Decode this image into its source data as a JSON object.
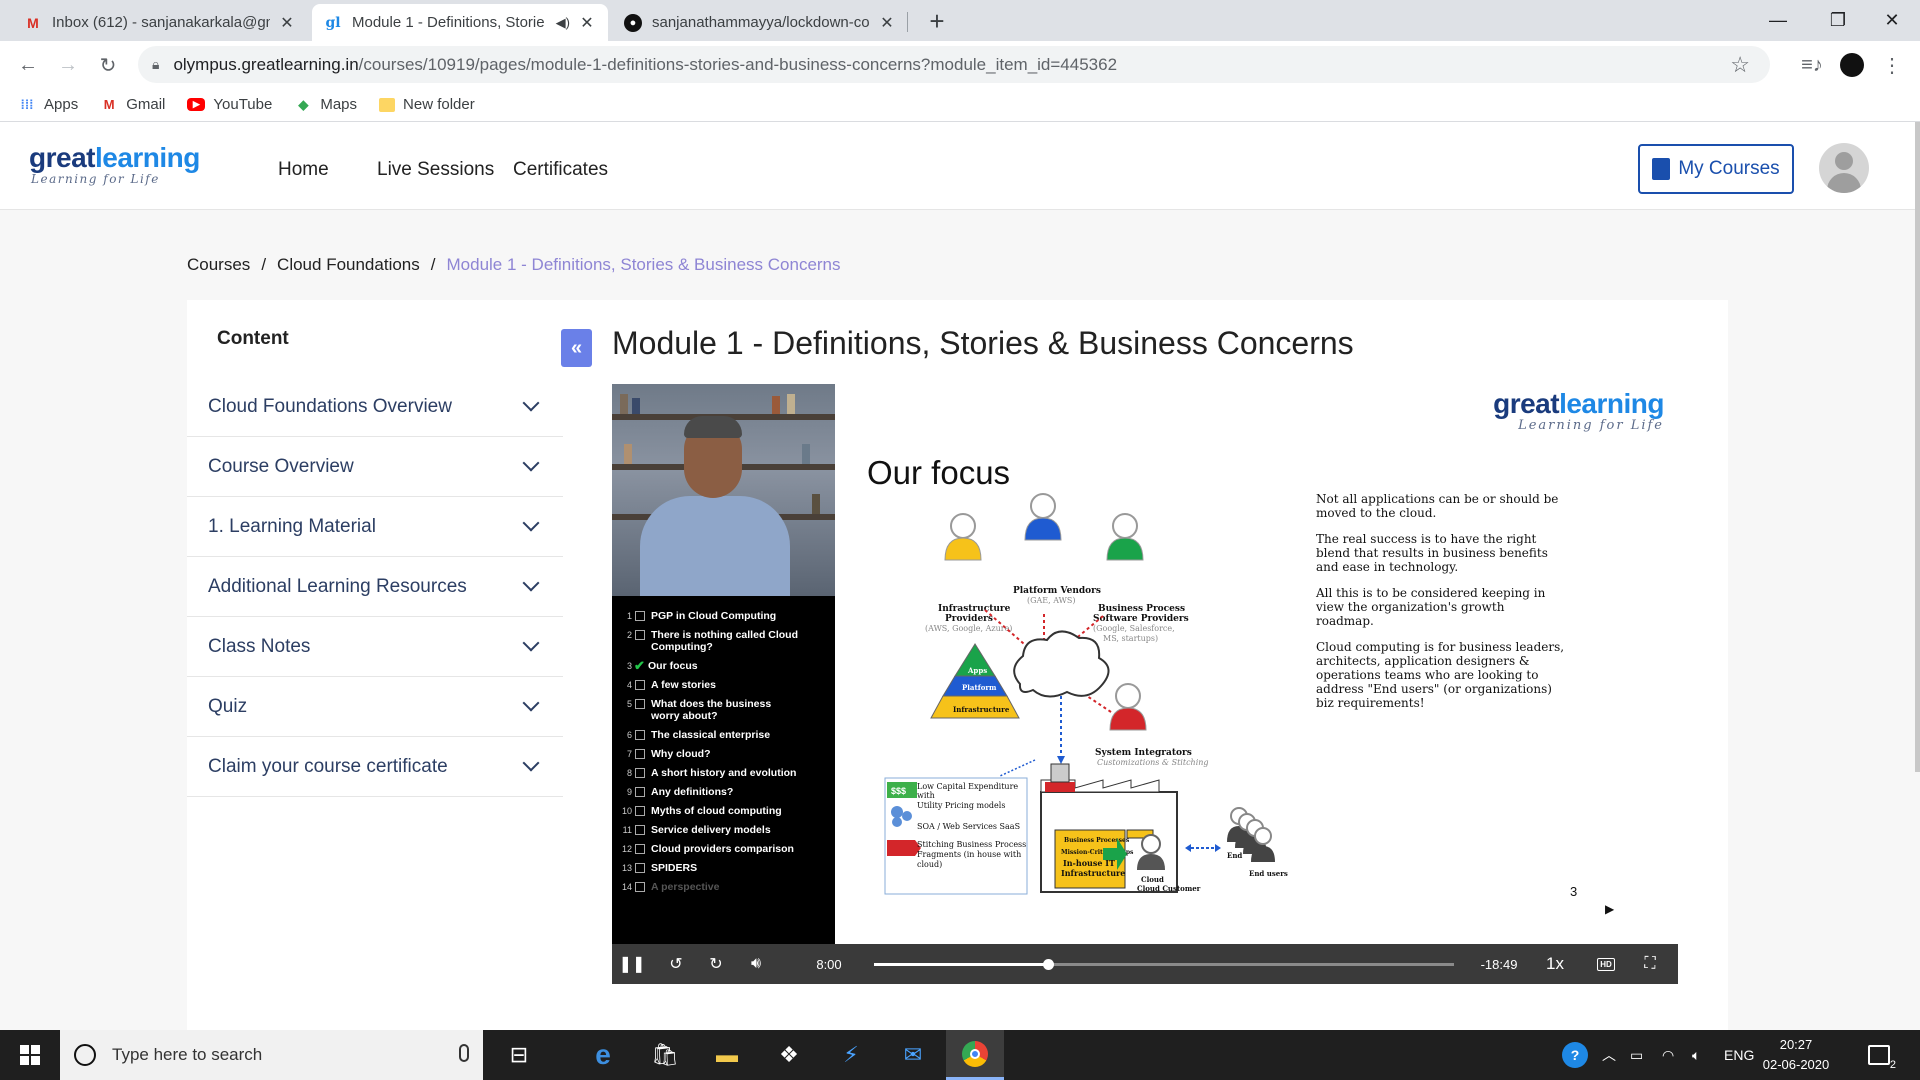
{
  "browser": {
    "tabs": [
      {
        "title": "Inbox (612) - sanjanakarkala@gm",
        "favicon": "gmail-icon"
      },
      {
        "title": "Module 1 - Definitions, Storie",
        "favicon": "greatlearning-icon",
        "active": true,
        "muted_icon": "speaker-icon"
      },
      {
        "title": "sanjanathammayya/lockdown-co",
        "favicon": "github-icon"
      }
    ],
    "new_tab": "+",
    "url_host": "olympus.greatlearning.in",
    "url_path": "/courses/10919/pages/module-1-definitions-stories-and-business-concerns?module_item_id=445362",
    "bookmarks": [
      {
        "label": "Apps",
        "icon": "apps-grid-icon"
      },
      {
        "label": "Gmail",
        "icon": "gmail-icon"
      },
      {
        "label": "YouTube",
        "icon": "youtube-icon"
      },
      {
        "label": "Maps",
        "icon": "maps-icon"
      },
      {
        "label": "New folder",
        "icon": "folder-icon"
      }
    ]
  },
  "site": {
    "logo_main_a": "great",
    "logo_main_b": "learning",
    "logo_sub": "Learning for Life",
    "nav": [
      "Home",
      "Live Sessions",
      "Certificates"
    ],
    "my_courses": "My Courses"
  },
  "breadcrumb": {
    "items": [
      "Courses",
      "Cloud Foundations"
    ],
    "current": "Module 1 - Definitions, Stories & Business Concerns",
    "separator": "/"
  },
  "sidebar": {
    "title": "Content",
    "items": [
      "Cloud Foundations Overview",
      "Course Overview",
      "1. Learning Material",
      "Additional Learning Resources",
      "Class Notes",
      "Quiz",
      "Claim your course certificate"
    ],
    "collapse_label": "«"
  },
  "page_title": "Module 1 - Definitions, Stories & Business Concerns",
  "video": {
    "chapters": [
      {
        "n": "1",
        "label": "PGP in Cloud Computing"
      },
      {
        "n": "2",
        "label": "There is nothing called Cloud Computing?"
      },
      {
        "n": "3",
        "label": "Our focus",
        "checked": true
      },
      {
        "n": "4",
        "label": "A few stories"
      },
      {
        "n": "5",
        "label": "What does the business worry about?"
      },
      {
        "n": "6",
        "label": "The classical enterprise"
      },
      {
        "n": "7",
        "label": "Why cloud?"
      },
      {
        "n": "8",
        "label": "A short history and evolution"
      },
      {
        "n": "9",
        "label": "Any definitions?"
      },
      {
        "n": "10",
        "label": "Myths of cloud computing"
      },
      {
        "n": "11",
        "label": "Service delivery models"
      },
      {
        "n": "12",
        "label": "Cloud providers comparison"
      },
      {
        "n": "13",
        "label": "SPIDERS"
      },
      {
        "n": "14",
        "label": "A perspective"
      }
    ],
    "slide": {
      "title": "Our focus",
      "paragraphs": [
        "Not all applications can be or should be moved to the cloud.",
        "The real success is to have the right blend that results in business benefits and ease in technology.",
        "All this is to be considered keeping in view the organization's growth roadmap.",
        "Cloud computing is for business leaders, architects, application designers & operations teams who are looking to address \"End users\" (or organizations) biz requirements!"
      ],
      "diagram": {
        "infra": "Infrastructure Providers",
        "infra_sub": "(AWS, Google, Azure)",
        "platform": "Platform Vendors",
        "platform_sub": "(GAE, AWS)",
        "bpsp": "Business Process Software Providers",
        "bpsp_sub": "(Google, Salesforce, MS, startups)",
        "si": "System Integrators",
        "si_sub": "Customizations & Stitching",
        "pyr_apps": "Apps",
        "pyr_platform": "Platform",
        "pyr_infra": "Infrastructure",
        "legend_1": "Low Capital Expenditure with Utility Pricing models",
        "legend_1_badge": "$$$",
        "legend_2": "SOA / Web Services SaaS",
        "legend_3": "Stitching Business Process Fragments (in house with cloud)",
        "inhouse": "In-house IT Infrastructure",
        "biz_proc": "Business Processes",
        "mission": "Mission-Critical Apps",
        "cloud_customer": "Cloud Customer",
        "end_users": "End users",
        "end_label": "End"
      },
      "page_number": "3"
    },
    "elapsed": "8:00",
    "remaining": "-18:49",
    "speed": "1x",
    "progress": 0.3
  },
  "taskbar": {
    "search_placeholder": "Type here to search",
    "lang": "ENG",
    "time": "20:27",
    "date": "02-06-2020",
    "notifications": "2"
  }
}
